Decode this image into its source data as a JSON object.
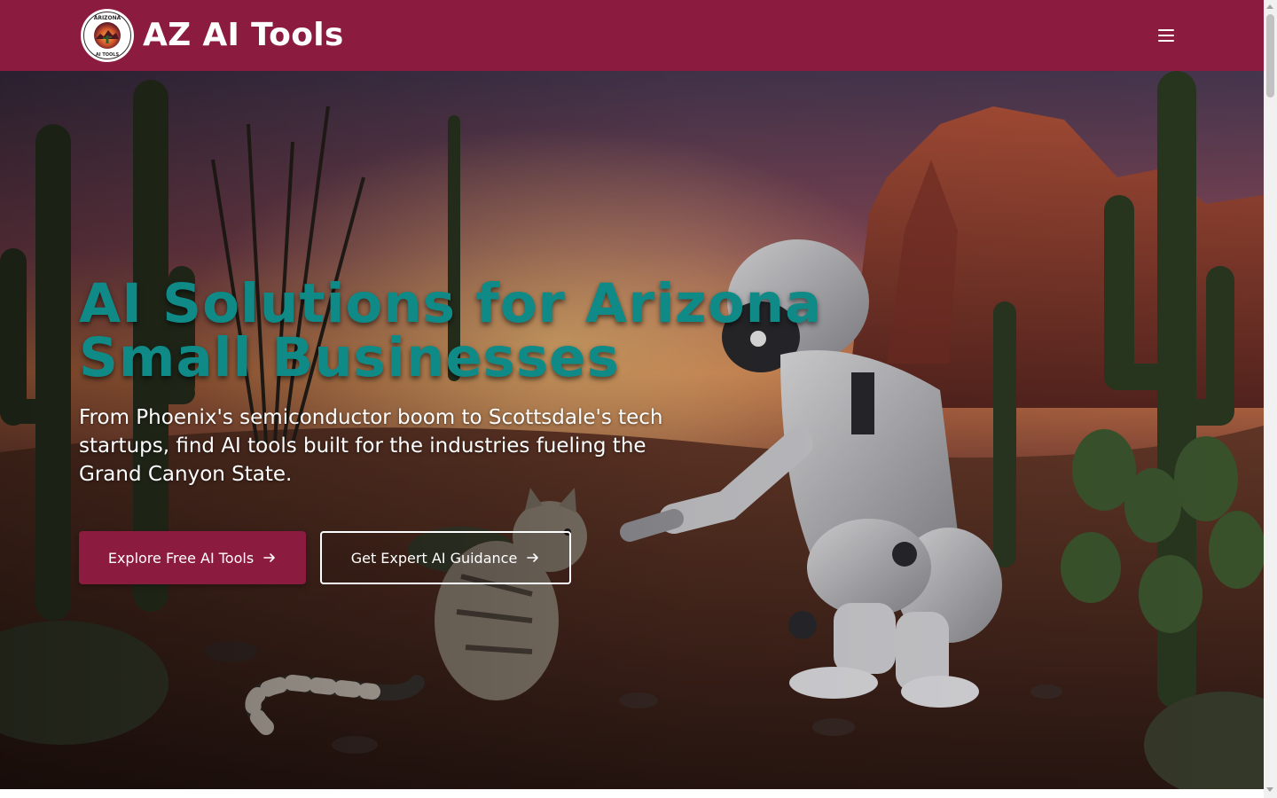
{
  "header": {
    "brand": "AZ AI Tools",
    "logo_icon": "arizona-ai-tools-logo-icon",
    "logo_text_top": "ARIZONA",
    "logo_text_bottom": "AI TOOLS",
    "menu_icon": "hamburger-menu-icon",
    "background_color": "#8c1b40"
  },
  "hero": {
    "background_image": "desert-robot-cat-sunset-photo",
    "title_line1": "AI Solutions for Arizona",
    "title_line2": "Small Businesses",
    "subtitle": "From Phoenix's semiconductor boom to Scottsdale's tech startups, find AI tools built for the industries fueling the Grand Canyon State.",
    "title_color": "#0f8a87",
    "primary_button": {
      "label": "Explore Free AI Tools",
      "icon": "arrow-right-icon"
    },
    "secondary_button": {
      "label": "Get Expert AI Guidance",
      "icon": "arrow-right-icon"
    }
  },
  "colors": {
    "brand": "#8c1b40",
    "accent": "#0f8a87",
    "text_light": "#ffffff"
  }
}
